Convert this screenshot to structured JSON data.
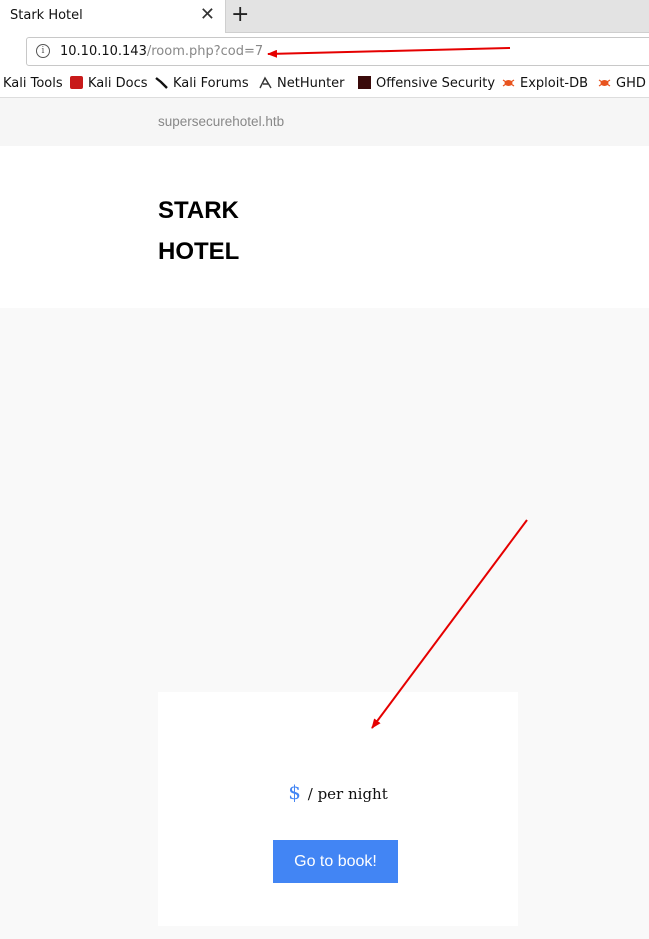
{
  "browser": {
    "tab_title": "Stark Hotel",
    "tab_close": "✕",
    "new_tab": "+",
    "url_host": "10.10.10.143",
    "url_path": "/room.php?cod=7",
    "bookmarks": [
      {
        "label": "Kali Tools"
      },
      {
        "label": "Kali Docs"
      },
      {
        "label": "Kali Forums"
      },
      {
        "label": "NetHunter"
      },
      {
        "label": "Offensive Security"
      },
      {
        "label": "Exploit-DB"
      },
      {
        "label": "GHD"
      }
    ]
  },
  "site": {
    "domain": "supersecurehotel.htb",
    "brand": "STARK HOTEL"
  },
  "room": {
    "currency": "$",
    "per_night": "/ per night",
    "book_button": "Go to book!"
  },
  "colors": {
    "accent": "#4285f4",
    "annotation": "#e50000"
  }
}
